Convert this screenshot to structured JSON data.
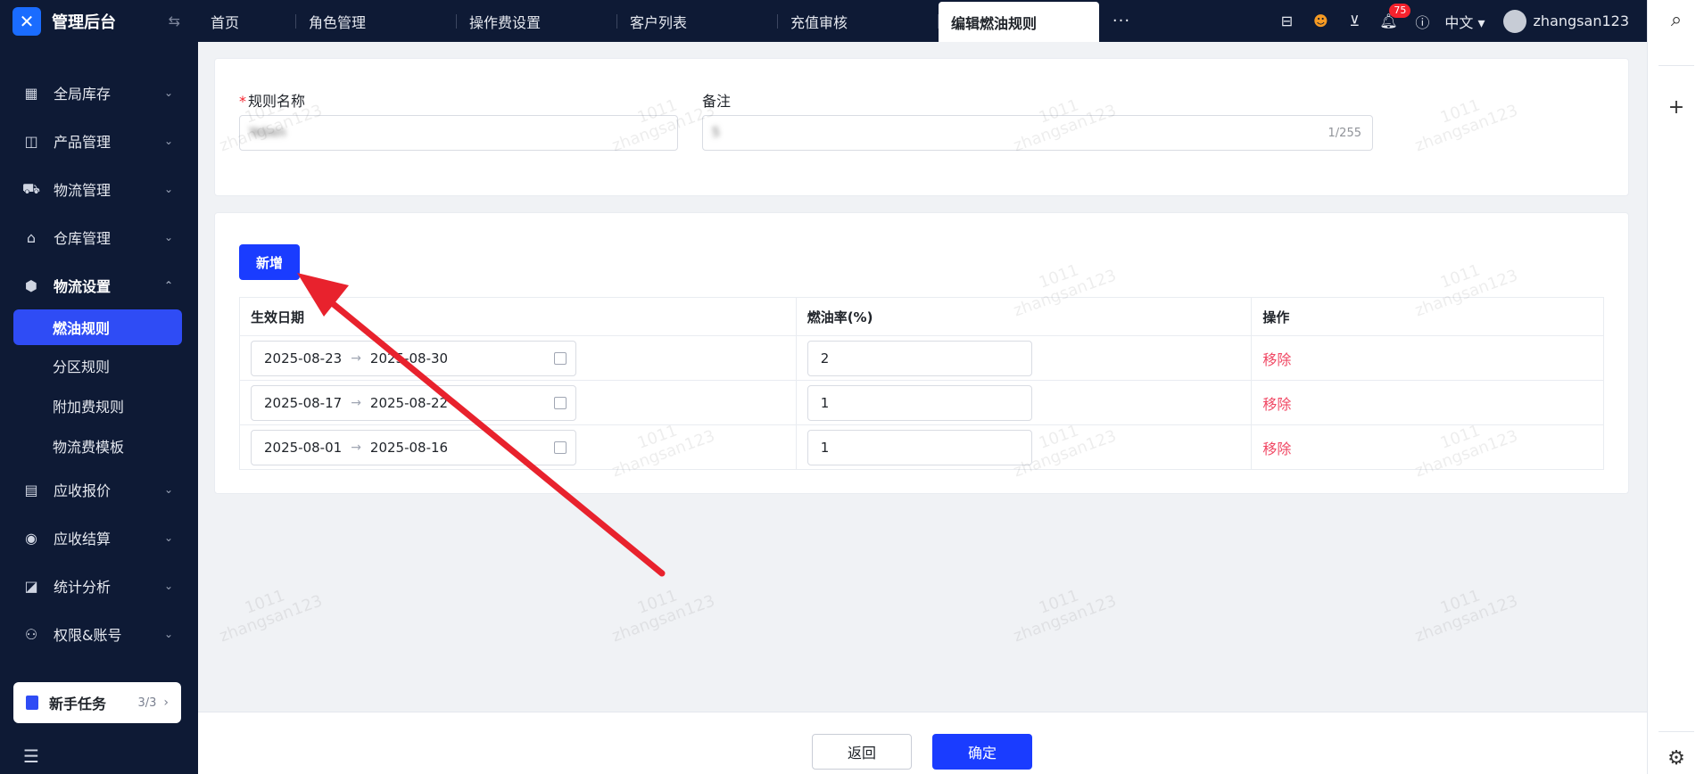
{
  "app": {
    "title": "管理后台"
  },
  "sidebar": {
    "items": [
      {
        "label": "全局库存",
        "icon": "store-icon"
      },
      {
        "label": "产品管理",
        "icon": "bag-icon"
      },
      {
        "label": "物流管理",
        "icon": "truck-icon"
      },
      {
        "label": "仓库管理",
        "icon": "warehouse-icon"
      },
      {
        "label": "物流设置",
        "icon": "box-icon"
      }
    ],
    "sub_items": [
      "燃油规则",
      "分区规则",
      "附加费规则",
      "物流费模板"
    ],
    "items_after": [
      {
        "label": "应收报价",
        "icon": "document-icon"
      },
      {
        "label": "应收结算",
        "icon": "coin-icon"
      },
      {
        "label": "统计分析",
        "icon": "chart-icon"
      },
      {
        "label": "权限&账号",
        "icon": "org-icon"
      }
    ],
    "task": {
      "label": "新手任务",
      "count": "3/3"
    }
  },
  "topbar": {
    "tabs": [
      "首页",
      "角色管理",
      "操作费设置",
      "客户列表",
      "充值审核",
      "编辑燃油规则"
    ],
    "notification_count": "75",
    "language": "中文",
    "username": "zhangsan123"
  },
  "form": {
    "rule_name_label": "规则名称",
    "rule_name_value": "Yeben",
    "remark_label": "备注",
    "remark_value": "5",
    "remark_counter": "1/255"
  },
  "table": {
    "add_label": "新增",
    "headers": [
      "生效日期",
      "燃油率(%)",
      "操作"
    ],
    "rows": [
      {
        "start": "2025-08-23",
        "end": "2025-08-30",
        "rate": "2",
        "action": "移除"
      },
      {
        "start": "2025-08-17",
        "end": "2025-08-22",
        "rate": "1",
        "action": "移除"
      },
      {
        "start": "2025-08-01",
        "end": "2025-08-16",
        "rate": "1",
        "action": "移除"
      }
    ]
  },
  "footer": {
    "back_label": "返回",
    "ok_label": "确定"
  },
  "watermark": {
    "line1": "1011",
    "line2": "zhangsan123"
  },
  "colors": {
    "primary": "#1a3cff",
    "sidebar_bg": "#0e1a35",
    "danger": "#f04864",
    "annotation_arrow": "#e8222d"
  }
}
